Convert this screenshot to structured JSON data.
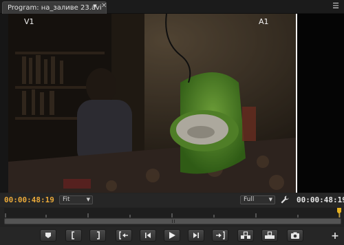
{
  "tab": {
    "label": "Program: на_заливе 23.avi"
  },
  "monitor": {
    "video_track": "V1",
    "audio_track": "A1"
  },
  "controls": {
    "current_timecode": "00:00:48:19",
    "zoom_select": "Fit",
    "quality_select": "Full",
    "duration_timecode": "00:00:48:19"
  },
  "colors": {
    "timecode_current": "#e9a93a",
    "playhead": "#e8b21e"
  },
  "transport": {
    "buttons": [
      "add-marker",
      "mark-in",
      "mark-out",
      "go-to-in",
      "step-back",
      "play",
      "step-forward",
      "go-to-out",
      "insert",
      "overwrite",
      "export-frame"
    ]
  }
}
